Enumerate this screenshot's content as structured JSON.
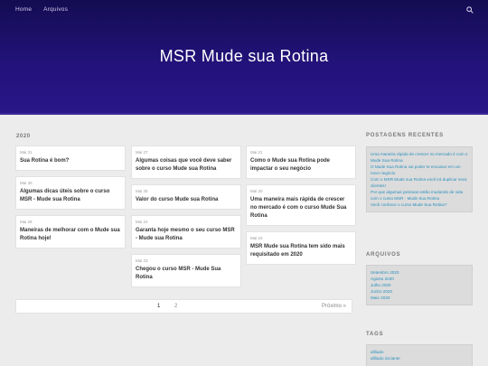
{
  "nav": {
    "items": [
      "Home",
      "Arquivos"
    ]
  },
  "site": {
    "title": "MSR Mude sua Rotina"
  },
  "archive": {
    "year": "2020",
    "columns": [
      [
        {
          "date": "Mai 31",
          "title": "Sua Rotina é bom?"
        },
        {
          "date": "Mai 30",
          "title": "Algumas dicas úteis sobre o curso MSR - Mude sua Rotina"
        },
        {
          "date": "Mai 28",
          "title": "Maneiras de melhorar com o Mude sua Rotina hoje!"
        }
      ],
      [
        {
          "date": "Mai 27",
          "title": "Algumas coisas que você deve saber sobre o curso Mude sua Rotina"
        },
        {
          "date": "Mai 25",
          "title": "Valor do curso Mude sua Rotina"
        },
        {
          "date": "Mai 24",
          "title": "Garanta hoje mesmo o seu curso MSR - Mude sua Rotina"
        },
        {
          "date": "Mai 23",
          "title": "Chegou o curso MSR - Mude Sua Rotina"
        }
      ],
      [
        {
          "date": "Mai 21",
          "title": "Como o Mude sua Rotina pode impactar o seu negócio"
        },
        {
          "date": "Mai 20",
          "title": "Uma maneira mais rápida de crescer no mercado é com o curso Mude Sua Rotina"
        },
        {
          "date": "Mai 19",
          "title": "MSR Mude sua Rotina tem sido mais requisitado em 2020"
        }
      ]
    ]
  },
  "pagination": {
    "page1": "1",
    "page2": "2",
    "next": "Próximo »"
  },
  "sidebar": {
    "recent_heading": "POSTAGENS RECENTES",
    "recent": [
      "Uma maneira rápida de crescer no mercado é com o Mude Sua Rotina",
      "O Mude Sua Rotina vai poder te encaixar em um novo negócio",
      "Com o MSR Mude sua Rotina você irá duplicar seus clientes!",
      "Por que algumas pessoas estão mudando de vida com o curso MSR - Mude Sua Rotina",
      "Você conhece o curso Mude Sua Rotina?"
    ],
    "archive_heading": "ARQUIVOS",
    "archives": [
      "Setembro 2020",
      "Agosto 2020",
      "Julho 2020",
      "Junho 2020",
      "Maio 2020"
    ],
    "tags_heading": "TAGS",
    "tags": [
      "afiliado",
      "afiliado iniciante"
    ]
  },
  "colors": {
    "hero_top": "#140c52",
    "hero_bottom": "#2a1688",
    "link": "#2a8fbd"
  },
  "icons": {
    "search": "search-icon"
  }
}
